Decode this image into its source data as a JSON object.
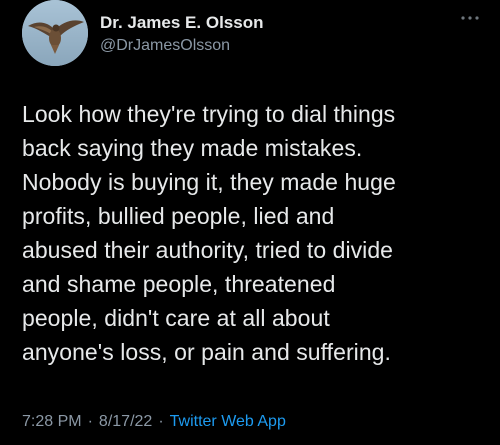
{
  "author": {
    "display_name": "Dr. James E. Olsson",
    "handle": "@DrJamesOlsson",
    "avatar_icon": "bird-of-prey-avatar"
  },
  "menu_icon": "more-dots-icon",
  "tweet": {
    "text": "Look how they're trying to dial things\nback saying they made mistakes.\nNobody is buying it, they made huge\nprofits, bullied people, lied and\nabused their authority, tried to divide\nand shame people, threatened\npeople, didn't care at all about\nanyone's loss, or pain and suffering."
  },
  "meta": {
    "time": "7:28 PM",
    "separator": "·",
    "date": "8/17/22",
    "source": "Twitter Web App"
  },
  "colors": {
    "background": "#000000",
    "text": "#e7e9ea",
    "secondary": "#8b98a5",
    "link": "#1d9bf0"
  }
}
